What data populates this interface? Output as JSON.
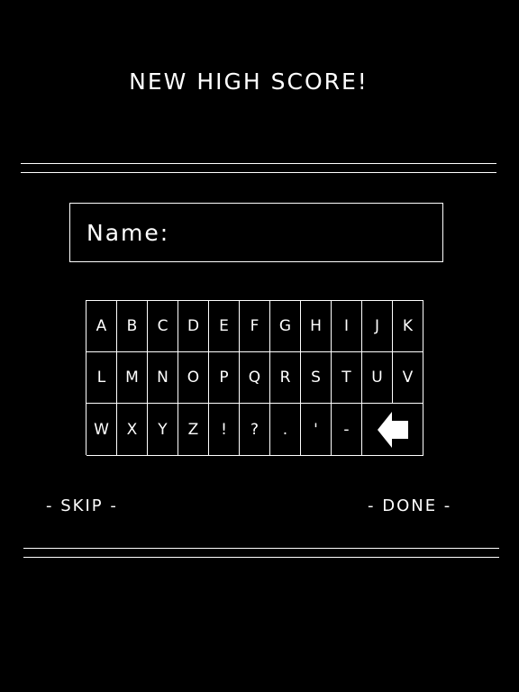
{
  "screen": {
    "title": "NEW HIGH SCORE!"
  },
  "name_field": {
    "label": "Name:",
    "value": ""
  },
  "keyboard": {
    "rows": [
      [
        "A",
        "B",
        "C",
        "D",
        "E",
        "F",
        "G",
        "H",
        "I",
        "J",
        "K"
      ],
      [
        "L",
        "M",
        "N",
        "O",
        "P",
        "Q",
        "R",
        "S",
        "T",
        "U",
        "V"
      ],
      [
        "W",
        "X",
        "Y",
        "Z",
        "!",
        "?",
        ".",
        "'",
        "-",
        "backspace"
      ]
    ],
    "backspace_icon": "left-arrow-icon"
  },
  "actions": {
    "skip_label": "- SKIP -",
    "done_label": "- DONE -"
  },
  "colors": {
    "background": "#000000",
    "foreground": "#ffffff"
  }
}
